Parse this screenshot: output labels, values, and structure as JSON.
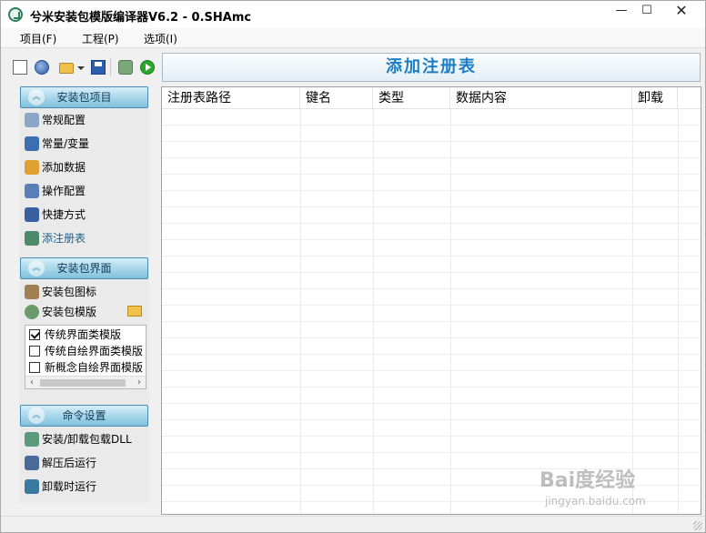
{
  "window": {
    "title": "兮米安装包模版编译器V6.2 - 0.SHAmc",
    "min_glyph": "—",
    "max_glyph": "☐",
    "close_glyph": "✕"
  },
  "menu": {
    "items": [
      {
        "label": "项目(F)"
      },
      {
        "label": "工程(P)"
      },
      {
        "label": "选项(I)"
      }
    ]
  },
  "banner": {
    "title": "添加注册表"
  },
  "sidebar": {
    "section1": {
      "title": "安装包项目"
    },
    "items1": [
      {
        "label": "常规配置",
        "icon": "settings-icon",
        "color": "#8aa6c8"
      },
      {
        "label": "常量/变量",
        "icon": "variables-icon",
        "color": "#3d6fb0"
      },
      {
        "label": "添加数据",
        "icon": "add-data-icon",
        "color": "#e0a030"
      },
      {
        "label": "操作配置",
        "icon": "operation-icon",
        "color": "#5a7fb8"
      },
      {
        "label": "快捷方式",
        "icon": "shortcut-icon",
        "color": "#3a5fa0"
      },
      {
        "label": "添注册表",
        "icon": "registry-icon",
        "color": "#4c8a6a"
      }
    ],
    "section2": {
      "title": "安装包界面"
    },
    "items2": [
      {
        "label": "安装包图标",
        "icon": "package-icon",
        "color": "#a08050"
      },
      {
        "label": "安装包模版",
        "icon": "template-icon",
        "color": "#6a9a6a"
      }
    ],
    "templates": [
      {
        "label": "传统界面类模版",
        "checked": true
      },
      {
        "label": "传统自绘界面类模版",
        "checked": false
      },
      {
        "label": "新概念自绘界面模版",
        "checked": false
      }
    ],
    "section3": {
      "title": "命令设置"
    },
    "items3": [
      {
        "label": "安装/卸载包载DLL",
        "icon": "dll-icon",
        "color": "#5a9a7a"
      },
      {
        "label": "解压后运行",
        "icon": "run-after-extract-icon",
        "color": "#4a6a9a"
      },
      {
        "label": "卸载时运行",
        "icon": "run-on-uninstall-icon",
        "color": "#3a7aa0"
      }
    ]
  },
  "grid": {
    "columns": [
      {
        "label": "注册表路径"
      },
      {
        "label": "键名"
      },
      {
        "label": "类型"
      },
      {
        "label": "数据内容"
      },
      {
        "label": "卸载"
      }
    ]
  },
  "watermark": {
    "text": "Bai度经验",
    "sub": "jingyan.baidu.com"
  }
}
